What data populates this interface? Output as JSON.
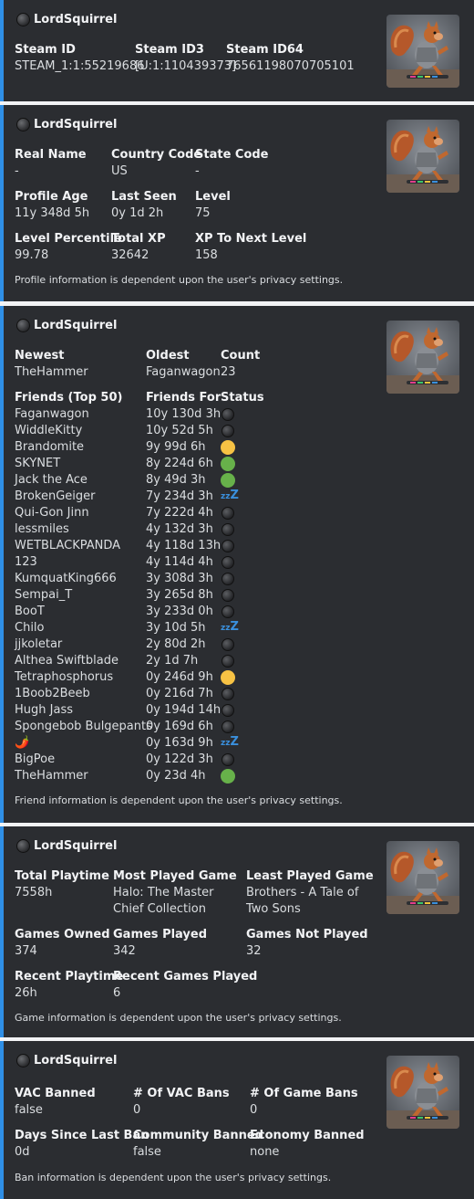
{
  "author_name": "LordSquirrel",
  "colors": {
    "accent": "#2f8fe6",
    "embed_bg": "#2b2d31",
    "idle": "#f7c244",
    "online": "#67b14a"
  },
  "icons": {
    "author": "steam-avatar-icon",
    "thumbnail": "squirrel-avatar",
    "sleep": "zzz-sleeping-icon"
  },
  "embeds": [
    {
      "fields": [
        {
          "name": "Steam ID",
          "value": "STEAM_1:1:55219686"
        },
        {
          "name": "Steam ID3",
          "value": "[U:1:110439373]"
        },
        {
          "name": "Steam ID64",
          "value": "76561198070705101"
        }
      ]
    },
    {
      "fields": [
        {
          "name": "Real Name",
          "value": "-"
        },
        {
          "name": "Country Code",
          "value": "US"
        },
        {
          "name": "State Code",
          "value": "-"
        },
        {
          "name": "Profile Age",
          "value": "11y 348d 5h"
        },
        {
          "name": "Last Seen",
          "value": "0y 1d 2h"
        },
        {
          "name": "Level",
          "value": "75"
        },
        {
          "name": "Level Percentile",
          "value": "99.78"
        },
        {
          "name": "Total XP",
          "value": "32642"
        },
        {
          "name": "XP To Next Level",
          "value": "158"
        }
      ],
      "footer": "Profile information is dependent upon the user's privacy settings."
    },
    {
      "fields": [
        {
          "name": "Newest",
          "value": "TheHammer"
        },
        {
          "name": "Oldest",
          "value": "Faganwagon"
        },
        {
          "name": "Count",
          "value": "23"
        },
        {
          "name": "Friends (Top 50)"
        },
        {
          "name": "Friends For"
        },
        {
          "name": "Status"
        }
      ],
      "friends": [
        {
          "name": "Faganwagon",
          "for": "10y 130d 3h",
          "status": "offline"
        },
        {
          "name": "WiddleKitty",
          "for": "10y 52d 5h",
          "status": "offline"
        },
        {
          "name": "Brandomite",
          "for": "9y 99d 6h",
          "status": "idle"
        },
        {
          "name": "SKYNET",
          "for": "8y 224d 6h",
          "status": "online"
        },
        {
          "name": "Jack the Ace",
          "for": "8y 49d 3h",
          "status": "online"
        },
        {
          "name": "BrokenGeiger",
          "for": "7y 234d 3h",
          "status": "sleep"
        },
        {
          "name": "Qui-Gon Jinn",
          "for": "7y 222d 4h",
          "status": "offline"
        },
        {
          "name": "lessmiles",
          "for": "4y 132d 3h",
          "status": "offline"
        },
        {
          "name": "WETBLACKPANDA",
          "for": "4y 118d 13h",
          "status": "offline"
        },
        {
          "name": "123",
          "for": "4y 114d 4h",
          "status": "offline"
        },
        {
          "name": "KumquatKing666",
          "for": "3y 308d 3h",
          "status": "offline"
        },
        {
          "name": "Sempai_T",
          "for": "3y 265d 8h",
          "status": "offline"
        },
        {
          "name": "BooT",
          "for": "3y 233d 0h",
          "status": "offline"
        },
        {
          "name": "Chilo",
          "for": "3y 10d 5h",
          "status": "sleep"
        },
        {
          "name": "jjkoletar",
          "for": "2y 80d 2h",
          "status": "offline"
        },
        {
          "name": "Althea Swiftblade",
          "for": "2y 1d 7h",
          "status": "offline"
        },
        {
          "name": "Tetraphosphorus",
          "for": "0y 246d 9h",
          "status": "idle"
        },
        {
          "name": "1Boob2Beeb",
          "for": "0y 216d 7h",
          "status": "offline"
        },
        {
          "name": "Hugh Jass",
          "for": "0y 194d 14h",
          "status": "offline"
        },
        {
          "name": "Spongebob Bulgepants",
          "for": "0y 169d 6h",
          "status": "offline"
        },
        {
          "name": "🌶️",
          "for": "0y 163d 9h",
          "status": "sleep"
        },
        {
          "name": "BigPoe",
          "for": "0y 122d 3h",
          "status": "offline"
        },
        {
          "name": "TheHammer",
          "for": "0y 23d 4h",
          "status": "online"
        }
      ],
      "footer": "Friend information is dependent upon the user's privacy settings."
    },
    {
      "fields": [
        {
          "name": "Total Playtime",
          "value": "7558h"
        },
        {
          "name": "Most Played Game",
          "value": "Halo: The Master Chief Collection"
        },
        {
          "name": "Least Played Game",
          "value": "Brothers - A Tale of Two Sons"
        },
        {
          "name": "Games Owned",
          "value": "374"
        },
        {
          "name": "Games Played",
          "value": "342"
        },
        {
          "name": "Games Not Played",
          "value": "32"
        },
        {
          "name": "Recent Playtime",
          "value": "26h"
        },
        {
          "name": "Recent Games Played",
          "value": "6"
        }
      ],
      "footer": "Game information is dependent upon the user's privacy settings."
    },
    {
      "fields": [
        {
          "name": "VAC Banned",
          "value": "false"
        },
        {
          "name": "# Of VAC Bans",
          "value": "0"
        },
        {
          "name": "# Of Game Bans",
          "value": "0"
        },
        {
          "name": "Days Since Last Ban",
          "value": "0d"
        },
        {
          "name": "Community Banned",
          "value": "false"
        },
        {
          "name": "Economy Banned",
          "value": "none"
        }
      ],
      "footer": "Ban information is dependent upon the user's privacy settings."
    }
  ]
}
